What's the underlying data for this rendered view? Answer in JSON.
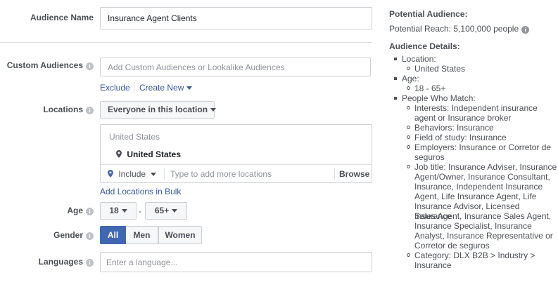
{
  "form": {
    "audience_name": {
      "label": "Audience Name",
      "value": "Insurance Agent Clients"
    },
    "custom_audiences": {
      "label": "Custom Audiences",
      "placeholder": "Add Custom Audiences or Lookalike Audiences",
      "exclude": "Exclude",
      "create_new": "Create New"
    },
    "locations": {
      "label": "Locations",
      "dropdown": "Everyone in this location",
      "group_header": "United States",
      "selected": "United States",
      "include": "Include",
      "search_placeholder": "Type to add more locations",
      "browse": "Browse",
      "bulk_link": "Add Locations in Bulk"
    },
    "age": {
      "label": "Age",
      "min": "18",
      "separator": "-",
      "max": "65+"
    },
    "gender": {
      "label": "Gender",
      "options": [
        "All",
        "Men",
        "Women"
      ],
      "selected": "All"
    },
    "languages": {
      "label": "Languages",
      "placeholder": "Enter a language..."
    }
  },
  "summary": {
    "potential_audience": {
      "heading": "Potential Audience:",
      "reach": "Potential Reach: 5,100,000 people"
    },
    "details_heading": "Audience Details:",
    "location": {
      "label": "Location:",
      "items": [
        "United States"
      ]
    },
    "age": {
      "label": "Age:",
      "items": [
        "18 - 65+"
      ]
    },
    "people_who_match": {
      "label": "People Who Match:",
      "lines": [
        "Interests: Independent insurance",
        "agent or Insurance broker",
        "Behaviors: Insurance",
        "Field of study: Insurance",
        "Employers: Insurance or Corretor de",
        "seguros",
        "Job title: Insurance Adviser, Insurance",
        "Agent/Owner, Insurance Consultant,",
        "Insurance, Independent Insurance",
        "Agent, Life Insurance Agent, Life",
        "Insurance Advisor, Licensed Insurance",
        "Sales Agent, Insurance Sales Agent,",
        "Insurance Specialist, Insurance",
        "Analyst, Insurance Representative or",
        "Corretor de seguros",
        "Category: DLX B2B > Industry >",
        "Insurance"
      ]
    }
  },
  "colors": {
    "link": "#365899",
    "active_button": "#4267b2",
    "label": "#4b4f56",
    "border": "#ccd0d5"
  },
  "icons": [
    "info-icon",
    "caret-down-icon",
    "location-pin-icon"
  ]
}
